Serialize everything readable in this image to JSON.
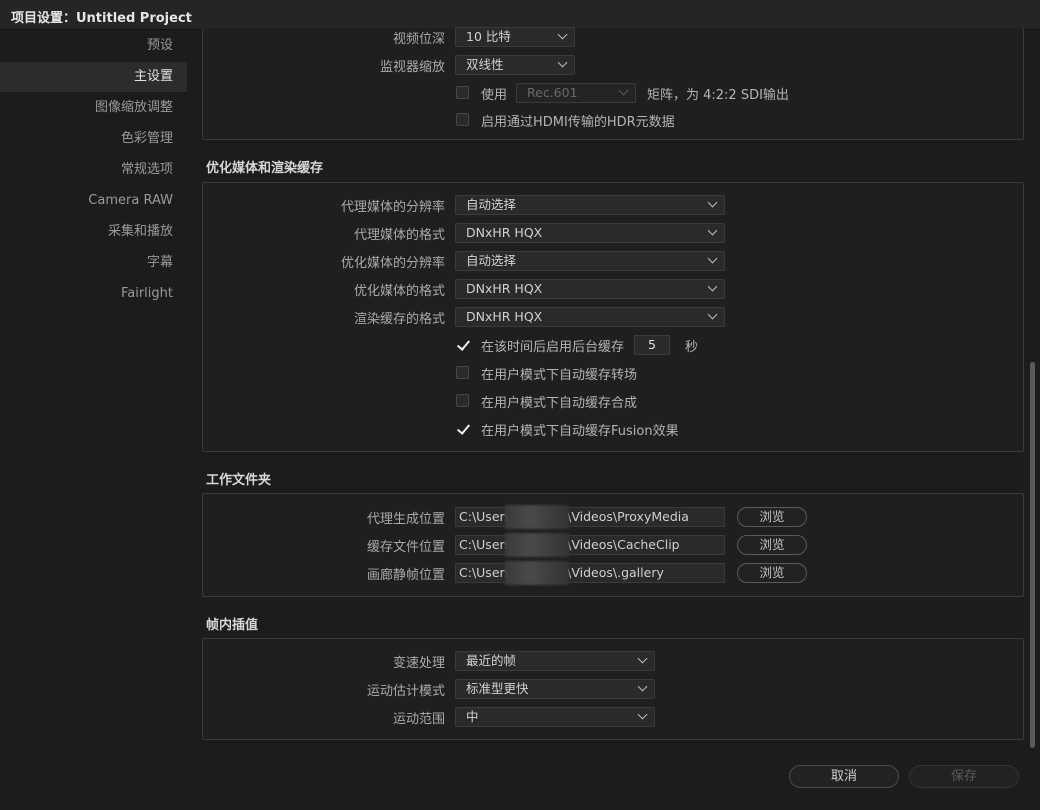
{
  "window": {
    "title": "项目设置：Untitled Project"
  },
  "sidebar": {
    "items": [
      {
        "label": "预设"
      },
      {
        "label": "主设置"
      },
      {
        "label": "图像缩放调整"
      },
      {
        "label": "色彩管理"
      },
      {
        "label": "常规选项"
      },
      {
        "label": "Camera RAW"
      },
      {
        "label": "采集和播放"
      },
      {
        "label": "字幕"
      },
      {
        "label": "Fairlight"
      }
    ],
    "active": "主设置"
  },
  "monitor": {
    "bit_depth_label": "视频位深",
    "bit_depth_value": "10 比特",
    "scaling_label": "监视器缩放",
    "scaling_value": "双线性",
    "use_label": "使用",
    "rec_value": "Rec.601",
    "matrix_label": "矩阵，为 4:2:2 SDI输出",
    "hdr_label": "启用通过HDMI传输的HDR元数据"
  },
  "cache": {
    "section_title": "优化媒体和渲染缓存",
    "proxy_res_label": "代理媒体的分辨率",
    "proxy_res_value": "自动选择",
    "proxy_fmt_label": "代理媒体的格式",
    "proxy_fmt_value": "DNxHR HQX",
    "opt_res_label": "优化媒体的分辨率",
    "opt_res_value": "自动选择",
    "opt_fmt_label": "优化媒体的格式",
    "opt_fmt_value": "DNxHR HQX",
    "render_fmt_label": "渲染缓存的格式",
    "render_fmt_value": "DNxHR HQX",
    "bg_cache_label": "在该时间后启用后台缓存",
    "bg_cache_seconds": "5",
    "bg_cache_unit": "秒",
    "transitions_label": "在用户模式下自动缓存转场",
    "composites_label": "在用户模式下自动缓存合成",
    "fusion_label": "在用户模式下自动缓存Fusion效果"
  },
  "folders": {
    "section_title": "工作文件夹",
    "rows": [
      {
        "label": "代理生成位置",
        "prefix": "C:\\Users",
        "suffix": "\\Videos\\ProxyMedia",
        "browse": "浏览"
      },
      {
        "label": "缓存文件位置",
        "prefix": "C:\\Users",
        "suffix": "\\Videos\\CacheClip",
        "browse": "浏览"
      },
      {
        "label": "画廊静帧位置",
        "prefix": "C:\\Users",
        "suffix": "\\Videos\\.gallery",
        "browse": "浏览"
      }
    ]
  },
  "interp": {
    "section_title": "帧内插值",
    "retime_label": "变速处理",
    "retime_value": "最近的帧",
    "motion_label": "运动估计模式",
    "motion_value": "标准型更快",
    "range_label": "运动范围",
    "range_value": "中"
  },
  "footer": {
    "cancel": "取消",
    "save": "保存"
  }
}
